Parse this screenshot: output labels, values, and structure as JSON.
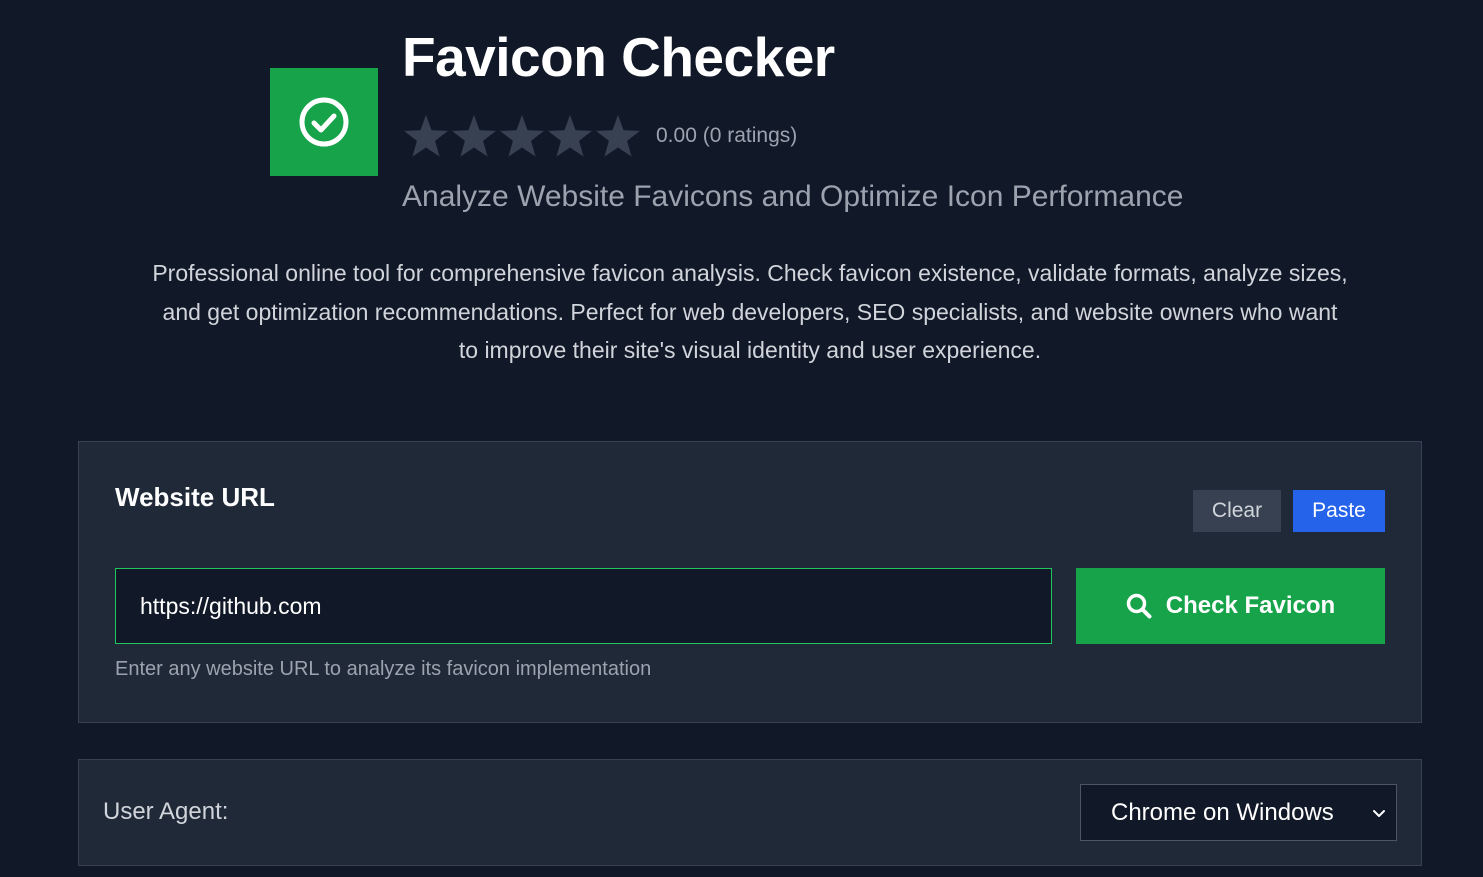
{
  "header": {
    "title": "Favicon Checker",
    "rating_value": "0.00 (0 ratings)",
    "rating_stars": 0,
    "subtitle": "Analyze Website Favicons and Optimize Icon Performance",
    "description": "Professional online tool for comprehensive favicon analysis. Check favicon existence, validate formats, analyze sizes, and get optimization recommendations. Perfect for web developers, SEO specialists, and website owners who want to improve their site's visual identity and user experience.",
    "logo_icon": "check-circle-icon"
  },
  "url_card": {
    "title": "Website URL",
    "clear_label": "Clear",
    "paste_label": "Paste",
    "input_value": "https://github.com",
    "check_label": "Check Favicon",
    "check_icon": "search-icon",
    "hint": "Enter any website URL to analyze its favicon implementation"
  },
  "ua_card": {
    "label": "User Agent:",
    "selected": "Chrome on Windows"
  },
  "colors": {
    "background": "#111827",
    "card": "#1f2937",
    "accent_green": "#16a34a",
    "accent_blue": "#2563eb",
    "star_empty": "#374151"
  }
}
